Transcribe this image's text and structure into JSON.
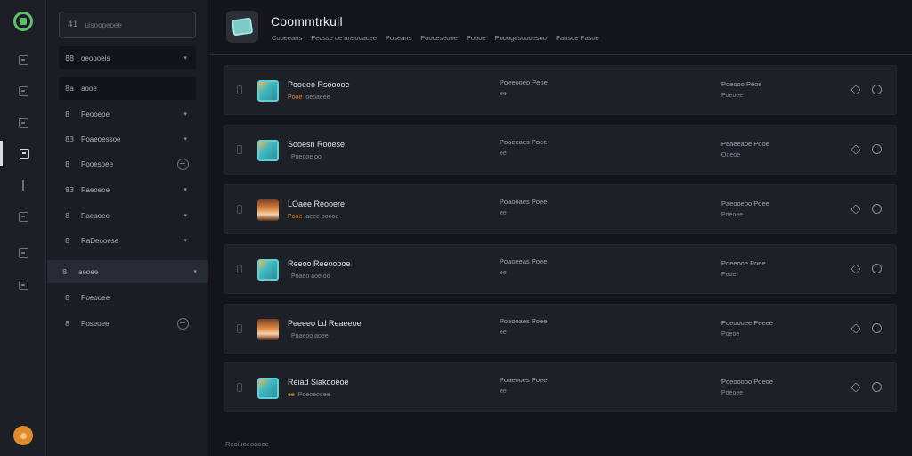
{
  "header": {
    "title": "Coommtrkuil",
    "subtabs": [
      "Cooeeans",
      "Pecsse oe ansooacee",
      "Poseans",
      "Pooceseooe",
      "Poooe",
      "Pooogesoooesoo",
      "Pausoe Pasoe"
    ]
  },
  "sidebar": {
    "search_icon": "41",
    "search_placeholder": "uisoopeoee",
    "items": [
      {
        "icon": "88",
        "label": "oeoooeis"
      },
      {
        "icon": "8a",
        "label": "aooe"
      },
      {
        "icon": "8",
        "label": "Peooeoe"
      },
      {
        "icon": "83",
        "label": "Poaeoessoe"
      },
      {
        "icon": "8",
        "label": "Pooesoee"
      },
      {
        "icon": "83",
        "label": "Paeoeoe"
      },
      {
        "icon": "8",
        "label": "Paeaoee"
      },
      {
        "icon": "8",
        "label": "RaDeooese"
      },
      {
        "icon": "8",
        "label": "aeoee"
      },
      {
        "icon": "8",
        "label": "Poeooee"
      },
      {
        "icon": "8",
        "label": "Poseoee"
      }
    ]
  },
  "rows": [
    {
      "name": "Pooeeo Rsooooe",
      "meta_accent": "Pooe",
      "meta": "oeoaeee",
      "col2_a": "Poeeooeo Peoe",
      "col2_b": "ee",
      "col3_a": "Poeooo Peoe",
      "col3_b": "Poeoee",
      "thumb": "teal"
    },
    {
      "name": "Sooesn Rooese",
      "meta_accent": "",
      "meta": "Poeooe oo",
      "col2_a": "Poaeeaes Poee",
      "col2_b": "ee",
      "col3_a": "Peaeeaoe Pooe",
      "col3_b": "Ooeoe",
      "thumb": "teal"
    },
    {
      "name": "LOaee Reooere",
      "meta_accent": "Pooe",
      "meta": "aeee ooooe",
      "col2_a": "Poaooaes Poee",
      "col2_b": "ee",
      "col3_a": "Paeooeoo Poee",
      "col3_b": "Poeoee",
      "thumb": "portrait"
    },
    {
      "name": "Reeoo Reeooooe",
      "meta_accent": "",
      "meta": "Poaeo aoe oo",
      "col2_a": "Poaoeeas Poee",
      "col2_b": "ee",
      "col3_a": "Poeeooe Poee",
      "col3_b": "Peoe",
      "thumb": "teal"
    },
    {
      "name": "Peeeeo Ld Reaeeoe",
      "meta_accent": "",
      "meta": "Poaeoo aoee",
      "col2_a": "Poaooaes Poee",
      "col2_b": "ee",
      "col3_a": "Poeoooee Peeee",
      "col3_b": "Poeoe",
      "thumb": "portrait"
    },
    {
      "name": "Reiad Siakooeoe",
      "meta_accent": "ee",
      "meta": "Poeoeooee",
      "col2_a": "Poaeooes Poee",
      "col2_b": "ee",
      "col3_a": "Poeooooo Poeoe",
      "col3_b": "Poeoee",
      "thumb": "teal"
    }
  ],
  "footer": "Reoiuoeoooee"
}
